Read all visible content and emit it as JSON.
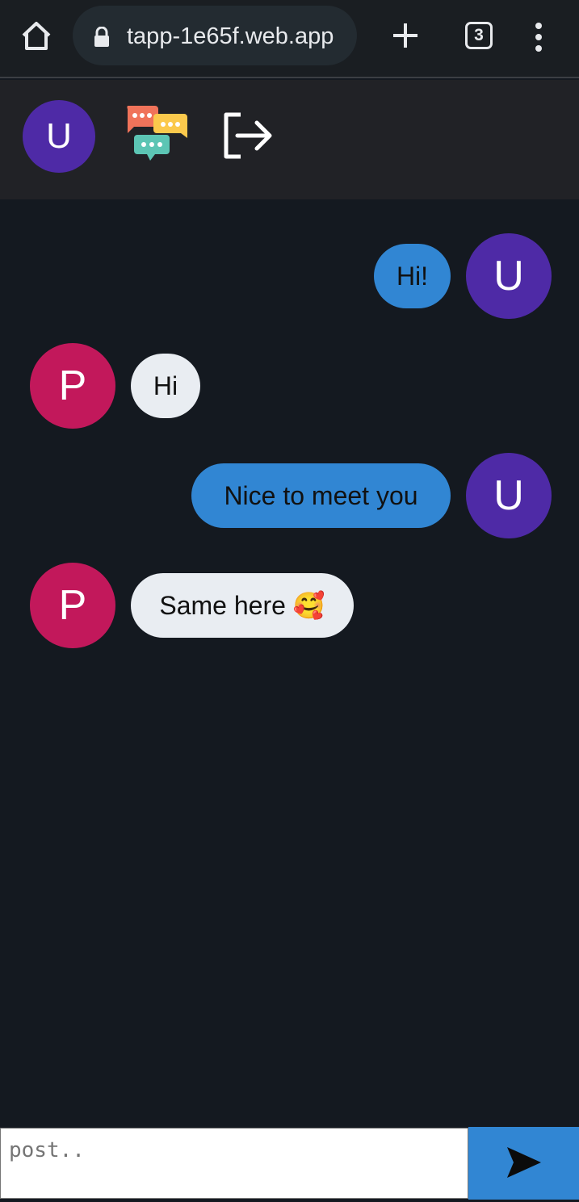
{
  "browser": {
    "url": "tapp-1e65f.web.app",
    "tab_count": "3"
  },
  "header": {
    "avatar_initial": "U"
  },
  "messages": [
    {
      "sender": "U",
      "direction": "sent",
      "text": "Hi!"
    },
    {
      "sender": "P",
      "direction": "received",
      "text": "Hi"
    },
    {
      "sender": "U",
      "direction": "sent",
      "text": "Nice to meet you"
    },
    {
      "sender": "P",
      "direction": "received",
      "text": "Same here 🥰"
    }
  ],
  "composer": {
    "placeholder": "post.."
  },
  "colors": {
    "user_avatar": "#4e2aa6",
    "partner_avatar": "#c2185b",
    "sent_bubble": "#3186d3",
    "received_bubble": "#e9edf2",
    "background": "#141920"
  },
  "icons": {
    "home": "home-icon",
    "lock": "lock-icon",
    "new_tab": "plus-icon",
    "menu": "more-vert-icon",
    "logo": "chat-bubbles-logo",
    "logout": "logout-icon",
    "send": "send-icon"
  }
}
